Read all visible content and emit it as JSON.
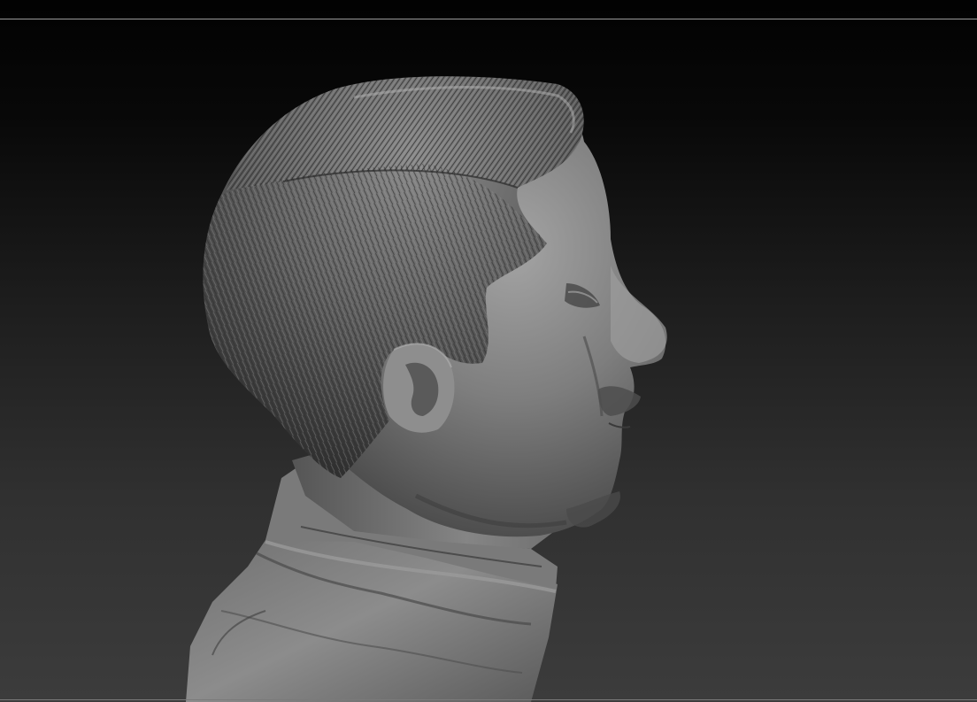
{
  "viewport": {
    "background_top": "#020202",
    "background_bottom": "#3c3c3c",
    "frame_line_color": "#9a9a9a"
  },
  "model": {
    "subject": "sculpted-male-bust-profile",
    "material_color": "#8a8a8a",
    "hair_color": "#5e5e5e",
    "view": "right-side-profile"
  }
}
